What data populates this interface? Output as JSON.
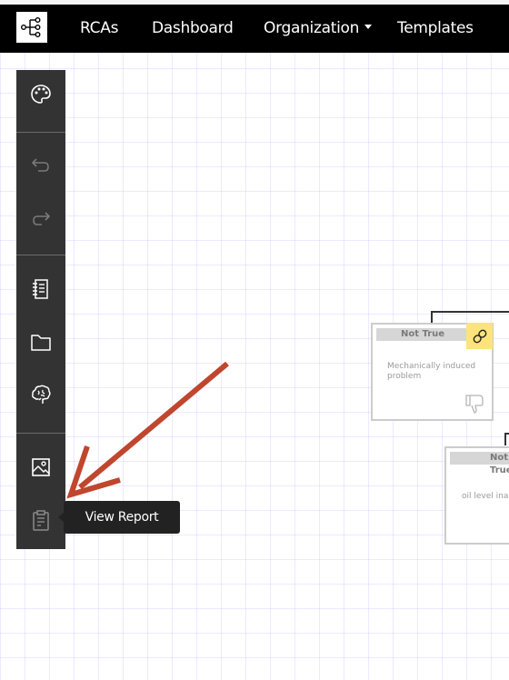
{
  "navbar": {
    "logo_icon": "tree-diagram-icon",
    "items": [
      {
        "label": "RCAs"
      },
      {
        "label": "Dashboard"
      },
      {
        "label": "Organization",
        "has_dropdown": true
      },
      {
        "label": "Templates"
      }
    ]
  },
  "toolbar": {
    "tools": [
      {
        "name": "palette",
        "icon": "palette-icon",
        "enabled": true
      },
      {
        "name": "undo",
        "icon": "undo-icon",
        "enabled": false
      },
      {
        "name": "redo",
        "icon": "redo-icon",
        "enabled": false
      },
      {
        "name": "notebook",
        "icon": "notebook-icon",
        "enabled": true
      },
      {
        "name": "folder",
        "icon": "folder-icon",
        "enabled": true
      },
      {
        "name": "brain",
        "icon": "brain-icon",
        "enabled": true
      },
      {
        "name": "image",
        "icon": "image-icon",
        "enabled": true
      },
      {
        "name": "view-report",
        "icon": "clipboard-icon",
        "enabled": true
      }
    ]
  },
  "tooltip": {
    "text": "View Report"
  },
  "annotation": {
    "type": "arrow",
    "color": "#c0462e",
    "points_to": "view-report"
  },
  "nodes": [
    {
      "status": "Not True",
      "text": "Mechanically induced problem",
      "has_link": true,
      "vote": "thumbs-down"
    },
    {
      "status": "Not True",
      "text": "oil level inap"
    }
  ],
  "colors": {
    "navbar_bg": "#000000",
    "toolbar_bg": "#333333",
    "link_badge": "#fde47a",
    "arrow": "#c0462e"
  }
}
